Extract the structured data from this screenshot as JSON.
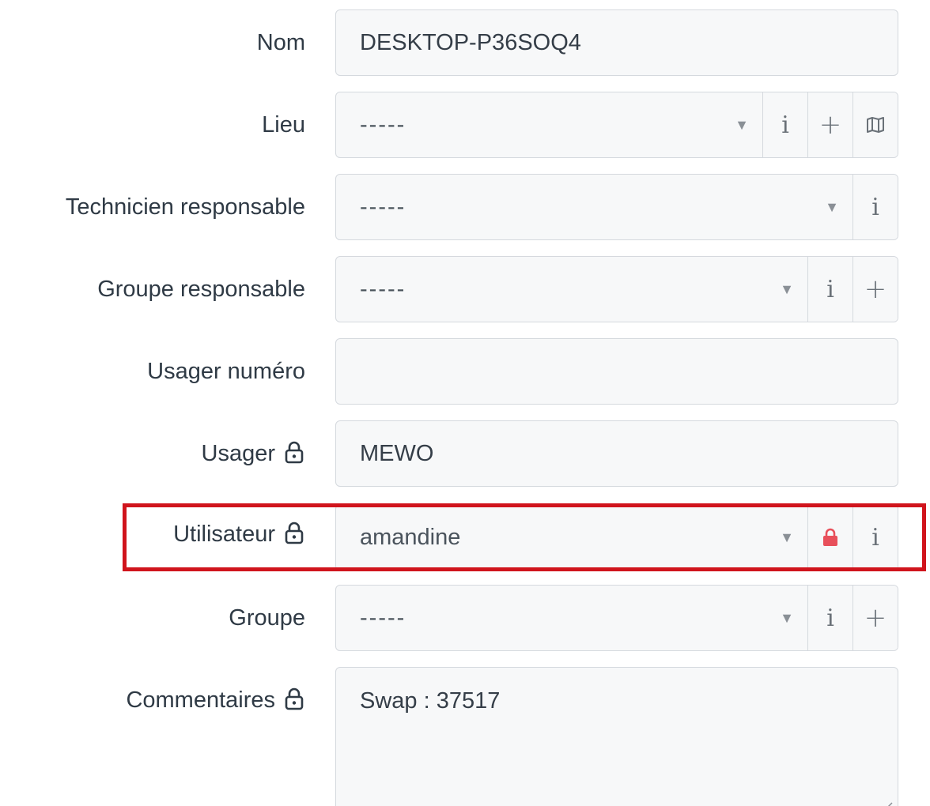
{
  "fields": {
    "nom": {
      "label": "Nom",
      "value": "DESKTOP-P36SOQ4"
    },
    "lieu": {
      "label": "Lieu",
      "value": "-----"
    },
    "technicien": {
      "label": "Technicien responsable",
      "value": "-----"
    },
    "groupe_responsable": {
      "label": "Groupe responsable",
      "value": "-----"
    },
    "usager_numero": {
      "label": "Usager numéro",
      "value": ""
    },
    "usager": {
      "label": "Usager",
      "value": "MEWO"
    },
    "utilisateur": {
      "label": "Utilisateur",
      "value": "amandine"
    },
    "groupe": {
      "label": "Groupe",
      "value": "-----"
    },
    "commentaires": {
      "label": "Commentaires",
      "value": "Swap : 37517"
    }
  },
  "buttons": {
    "info": "i",
    "add": "+"
  },
  "icons": {
    "lock": "lock-icon",
    "lock_red": "lock-red-icon",
    "map": "map-icon",
    "caret": "caret-down-icon"
  },
  "colors": {
    "highlight_border": "#d0141c",
    "lock_active": "#e8505b",
    "field_bg": "#f7f8f9",
    "field_border": "#d5d9de"
  }
}
